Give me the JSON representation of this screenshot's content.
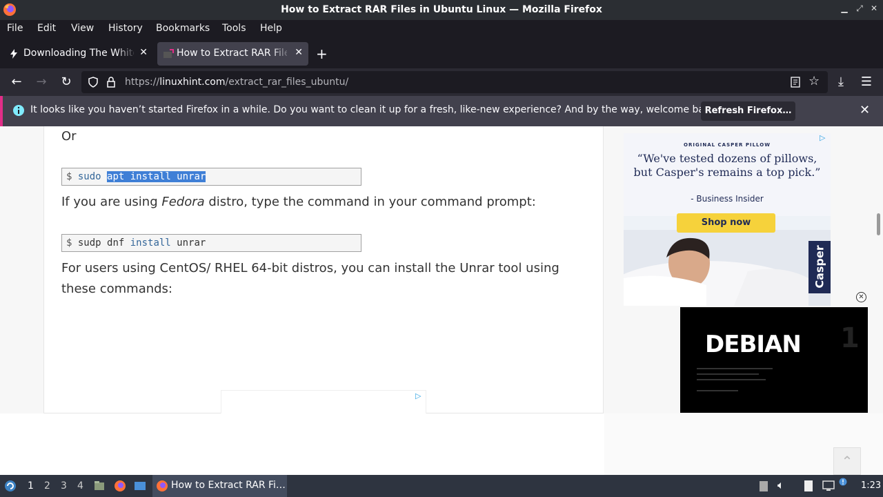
{
  "window": {
    "title": "How to Extract RAR Files in Ubuntu Linux — Mozilla Firefox"
  },
  "menu": [
    "File",
    "Edit",
    "View",
    "History",
    "Bookmarks",
    "Tools",
    "Help"
  ],
  "tabs": [
    {
      "label": "Downloading The White K",
      "active": false
    },
    {
      "label": "How to Extract RAR Files",
      "active": true
    }
  ],
  "urlbar": {
    "scheme": "https://",
    "host": "linuxhint.com",
    "path": "/extract_rar_files_ubuntu/"
  },
  "notification": {
    "message": "It looks like you haven’t started Firefox in a while. Do you want to clean it up for a fresh, like-new experience? And by the way, welcome back!",
    "button_label": "Refresh Firefox…"
  },
  "article": {
    "or_text": "Or",
    "cmd1": {
      "prompt": "$",
      "sudo": "sudo",
      "selected": "apt install unrar"
    },
    "fedora_pre": "If you are using ",
    "fedora_em": "Fedora",
    "fedora_post": " distro, type the command in your command prompt:",
    "cmd2": {
      "prompt": "$",
      "part1": "sudp dnf ",
      "kw": "install",
      "part2": " unrar"
    },
    "centos_line1": "For users using CentOS/ RHEL 64-bit distros, you can install the Unrar tool using",
    "centos_line2": "these commands:"
  },
  "ads": {
    "casper": {
      "brand": "ORIGINAL CASPER PILLOW",
      "quote_line1": "“We've tested dozens of pillows,",
      "quote_line2": "but Casper's remains a top pick.”",
      "source": "- Business Insider",
      "cta": "Shop now",
      "side_label": "Casper"
    },
    "debian": {
      "logo": "DEBIAN",
      "number": "1"
    }
  },
  "taskbar": {
    "workspaces": [
      "1",
      "2",
      "3",
      "4"
    ],
    "active_workspace": "1",
    "task_label": "How to Extract RAR Fi…",
    "clock": "1:23"
  },
  "colors": {
    "accent": "#e22e88",
    "selection": "#3f7fd6",
    "shop_button": "#f6d23b",
    "casper_navy": "#1f2a55"
  }
}
